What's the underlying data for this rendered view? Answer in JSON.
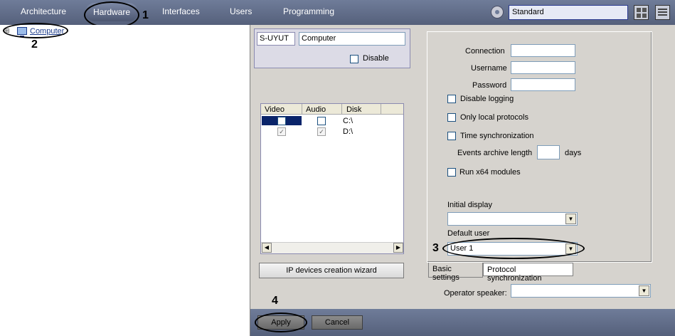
{
  "top_nav": {
    "tabs": [
      "Architecture",
      "Hardware",
      "Interfaces",
      "Users",
      "Programming"
    ],
    "active_tab": "Hardware",
    "mode_value": "Standard"
  },
  "tree": {
    "root_label": "Computer",
    "expander": "⊞"
  },
  "server": {
    "id_label": "S-UYUT",
    "name_value": "Computer",
    "disable_label": "Disable"
  },
  "disk_table": {
    "headers": [
      "Video",
      "Audio",
      "Disk"
    ],
    "rows": [
      {
        "disk": "C:\\"
      },
      {
        "disk": "D:\\"
      }
    ]
  },
  "wizard_button": "IP devices creation wizard",
  "settings": {
    "connection_label": "Connection",
    "username_label": "Username",
    "password_label": "Password",
    "disable_logging_label": "Disable logging",
    "only_local_label": "Only local protocols",
    "time_sync_label": "Time synchronization",
    "events_archive_label": "Events archive length",
    "days_label": "days",
    "run_x64_label": "Run x64 modules",
    "initial_display_label": "Initial display",
    "default_user_label": "Default user",
    "default_user_value": "User 1"
  },
  "tabs_bottom": {
    "basic": "Basic settings",
    "protocol": "Protocol synchronization"
  },
  "operator_speaker_label": "Operator speaker:",
  "buttons": {
    "apply": "Apply",
    "cancel": "Cancel"
  },
  "annotations": [
    "1",
    "2",
    "3",
    "4"
  ]
}
